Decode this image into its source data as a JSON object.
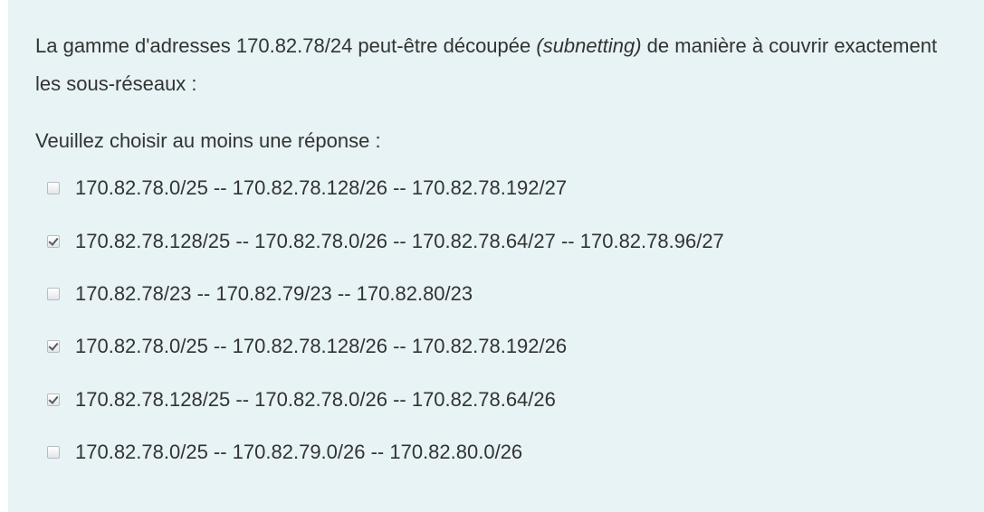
{
  "question": {
    "text_before": "La gamme d'adresses 170.82.78/24 peut-être découpée ",
    "text_italic": "(subnetting)",
    "text_after": " de manière à couvrir exactement les sous-réseaux :"
  },
  "prompt": "Veuillez choisir au moins une réponse :",
  "answers": [
    {
      "label": "170.82.78.0/25 -- 170.82.78.128/26 -- 170.82.78.192/27",
      "checked": false
    },
    {
      "label": "170.82.78.128/25 -- 170.82.78.0/26 -- 170.82.78.64/27 -- 170.82.78.96/27",
      "checked": true
    },
    {
      "label": "170.82.78/23 -- 170.82.79/23 -- 170.82.80/23",
      "checked": false
    },
    {
      "label": "170.82.78.0/25 -- 170.82.78.128/26 -- 170.82.78.192/26",
      "checked": true
    },
    {
      "label": "170.82.78.128/25 -- 170.82.78.0/26 -- 170.82.78.64/26",
      "checked": true
    },
    {
      "label": "170.82.78.0/25 -- 170.82.79.0/26 -- 170.82.80.0/26",
      "checked": false
    }
  ],
  "colors": {
    "panel_background": "#e7f3f5",
    "text": "#333333"
  }
}
